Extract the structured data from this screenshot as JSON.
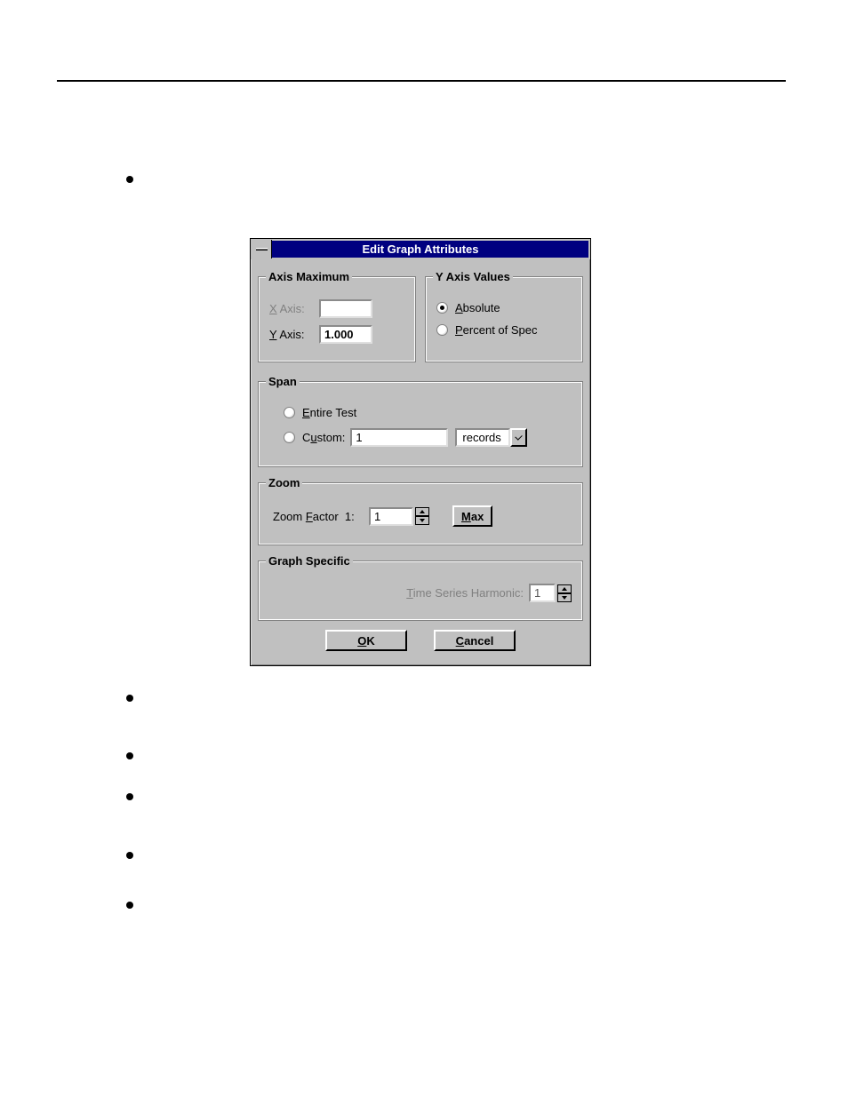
{
  "dialog": {
    "title": "Edit Graph Attributes",
    "axis_maximum": {
      "legend": "Axis Maximum",
      "x_label": "X Axis:",
      "x_value": "",
      "x_enabled": false,
      "y_label": "Y Axis:",
      "y_value": "1.000"
    },
    "y_axis_values": {
      "legend": "Y Axis Values",
      "absolute": {
        "label": "Absolute",
        "checked": true
      },
      "percent": {
        "label": "Percent of Spec",
        "checked": false
      }
    },
    "span": {
      "legend": "Span",
      "entire_test": {
        "label": "Entire Test",
        "checked": false
      },
      "custom": {
        "label": "Custom:",
        "checked": false
      },
      "custom_value": "1",
      "custom_unit": "records"
    },
    "zoom": {
      "legend": "Zoom",
      "label": "Zoom Factor  1:",
      "value": "1",
      "max_button": "Max"
    },
    "graph_specific": {
      "legend": "Graph Specific",
      "label": "Time Series Harmonic:",
      "value": "1",
      "enabled": false
    },
    "buttons": {
      "ok": "OK",
      "cancel": "Cancel"
    }
  }
}
